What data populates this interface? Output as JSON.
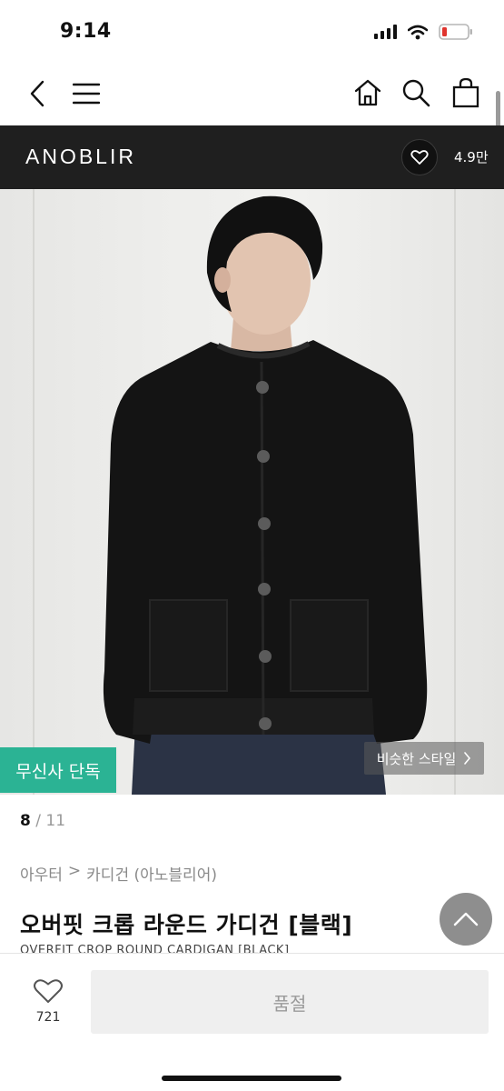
{
  "status_bar": {
    "time": "9:14"
  },
  "navbar": {
    "back_icon": "chevron-left-icon",
    "menu_icon": "hamburger-icon",
    "home_icon": "home-icon",
    "search_icon": "search-icon",
    "cart_icon": "shopping-bag-icon"
  },
  "brand": {
    "name": "ANOBLIR",
    "like_count": "4.9만"
  },
  "hero": {
    "exclusive_badge": "무신사 단독",
    "similar_style": "비슷한 스타일",
    "similar_style_icon": "chevron-right-icon"
  },
  "pager": {
    "current": "8",
    "separator": "/",
    "total": "11"
  },
  "breadcrumb": {
    "category": "아우터",
    "separator": ">",
    "subcategory": "카디건 (아노블리어)"
  },
  "product": {
    "title": "오버핏 크롭 라운드 가디건 [블랙]",
    "subtitle": "OVERFIT CROP ROUND CARDIGAN [BLACK]"
  },
  "bottom_bar": {
    "wish_count": "721",
    "soldout_label": "품절"
  },
  "colors": {
    "brand_bar": "#1f1f1f",
    "exclusive_badge": "#2bb394",
    "soldout_button": "#efefef"
  }
}
